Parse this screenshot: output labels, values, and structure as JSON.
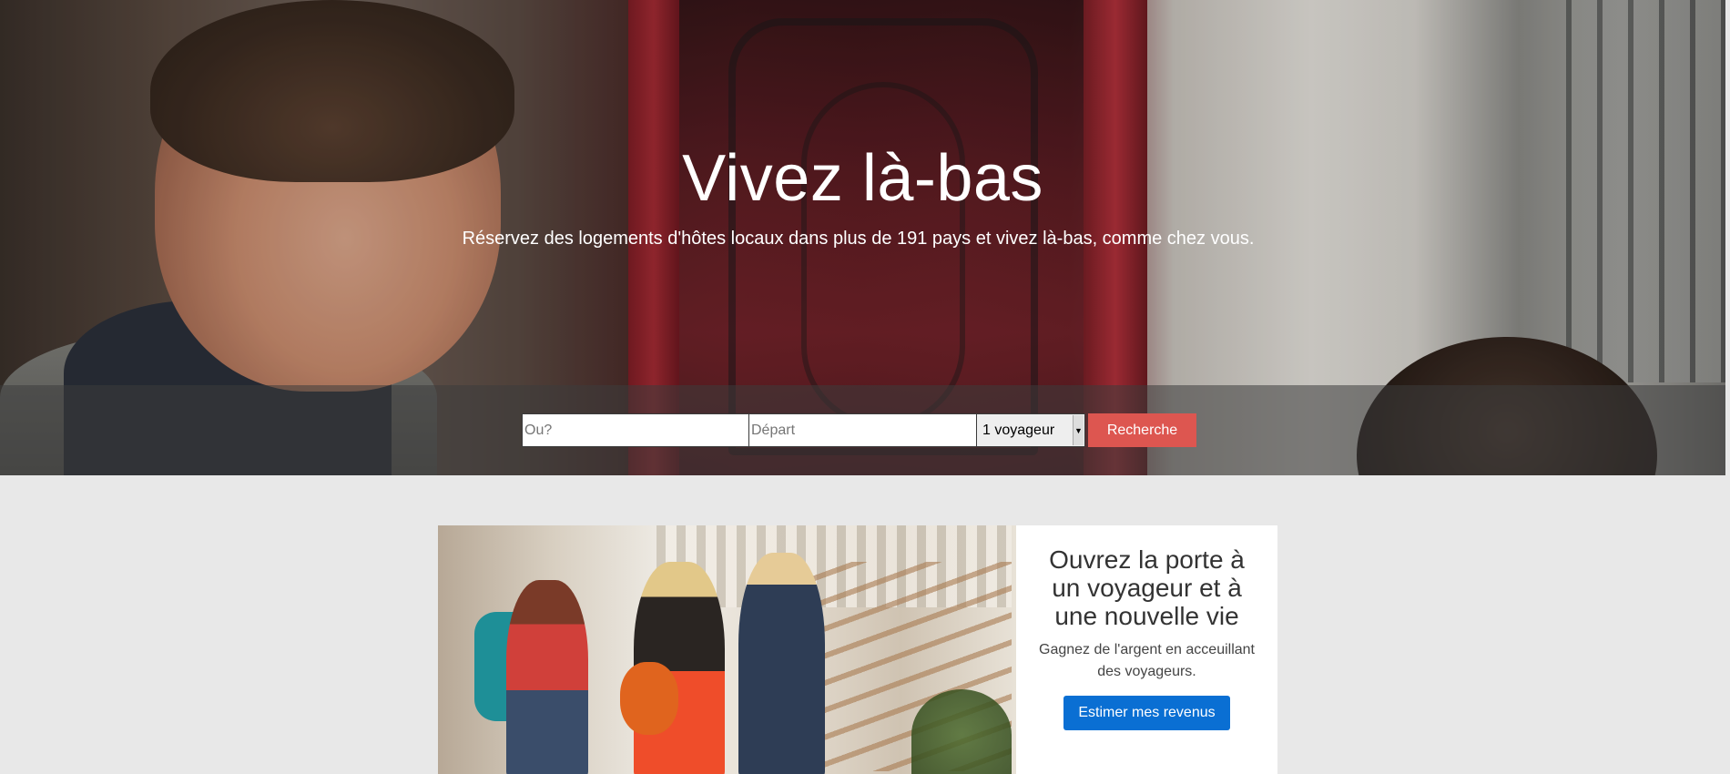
{
  "hero": {
    "title": "Vivez là-bas",
    "subtitle": "Réservez des logements d'hôtes locaux dans plus de 191 pays et vivez là-bas, comme chez vous."
  },
  "search": {
    "where_placeholder": "Ou?",
    "depart_placeholder": "Départ",
    "guests_selected": "1 voyageur",
    "button_label": "Recherche"
  },
  "host_promo": {
    "title": "Ouvrez la porte à un voyageur et à une nouvelle vie",
    "text": "Gagnez de l'argent en acceuillant des voyageurs.",
    "button_label": "Estimer mes revenus"
  },
  "colors": {
    "search_button": "#dd5650",
    "promo_button": "#0a6fd3",
    "page_background": "#e8e8e8"
  }
}
